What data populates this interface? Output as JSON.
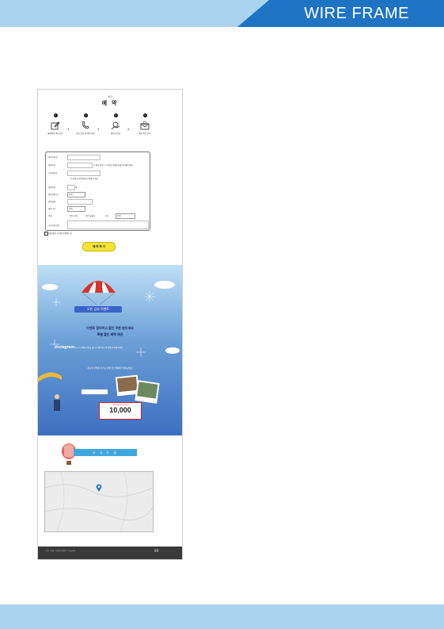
{
  "header": {
    "title": "WIRE FRAME"
  },
  "reservation": {
    "small_text": "예약",
    "title": "예 약",
    "steps": [
      {
        "num": "1",
        "caption": "홈페이지 예약 접수",
        "icon": "edit-icon"
      },
      {
        "num": "2",
        "caption": "상담 전화 및 예약 확정",
        "icon": "phone-icon"
      },
      {
        "num": "3",
        "caption": "예약금 입금",
        "icon": "payment-icon"
      },
      {
        "num": "4",
        "caption": "예약 완료 안내",
        "icon": "mail-icon"
      }
    ],
    "fields": [
      {
        "label": "예약자성명"
      },
      {
        "label": "비밀번호",
        "note": "※ 예약 확인 시 사용할 비밀번호를 입력해주세요."
      },
      {
        "label": "휴대폰번호",
        "note": "※ 정확한 연락처를 입력해 주세요."
      },
      {
        "label": "예약인원",
        "unit": "명"
      },
      {
        "label": "예약희망코스",
        "select": "선택"
      },
      {
        "label": "예약날짜"
      },
      {
        "label": "예약시간",
        "select": "선택"
      },
      {
        "label": "픽업",
        "opt1": "픽업 신청",
        "opt2": "픽업 불필요",
        "opt3": "기타",
        "select": "선택"
      },
      {
        "label": "기타요청사항"
      }
    ],
    "agree": "개인정보 수집에 동의합니다.",
    "submit": "예 약 하 기"
  },
  "promo": {
    "banner": "오픈 감사 이벤트",
    "line1": "이벤트 참여하고 할인 쿠폰 받으세요",
    "line2": "특별 할인 혜택 제공",
    "insta": "Instagram",
    "insta_desc": "인스타그램에 사진을 올리고 해시태그와 함께 공유해주세요.",
    "question": "최고의 추억을 남기고 특별 할인 혜택을 받아보세요!",
    "coupon_label": "SPECIAL COUPON",
    "coupon_value": "10,000"
  },
  "location": {
    "title": "오 시 는 길"
  },
  "footer": {
    "text": "주소 · 전화 · 사업자등록번호 · Copyright",
    "logo": "로고"
  }
}
